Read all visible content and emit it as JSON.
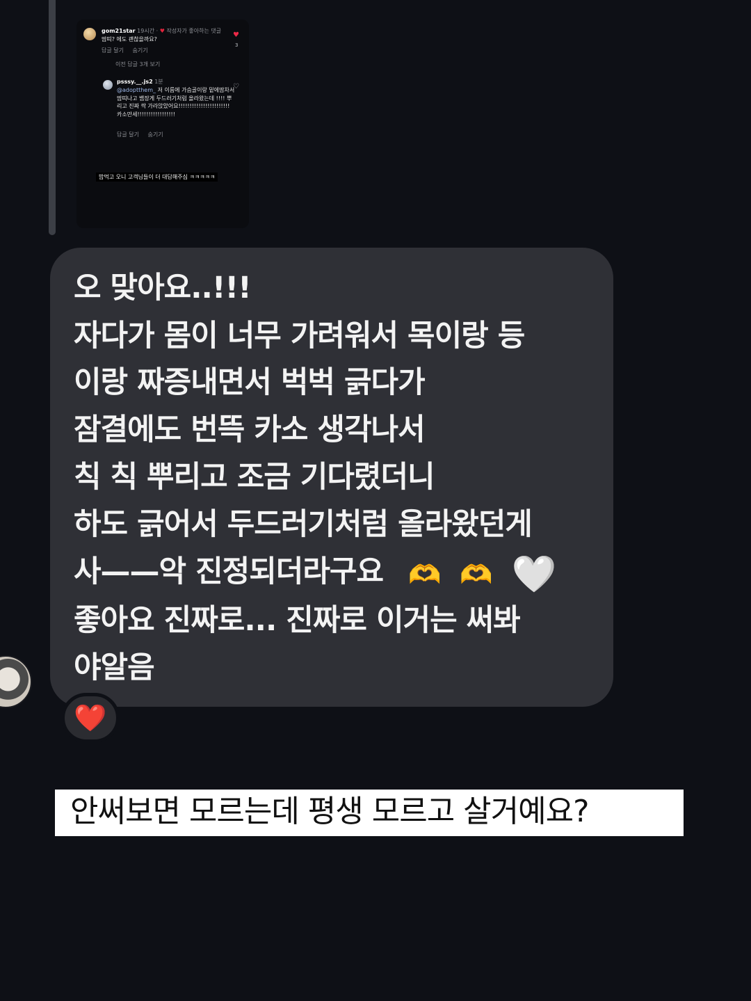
{
  "shared_post": {
    "comment": {
      "username": "gom21star",
      "time": "19시간",
      "creator_liked": "작성자가 좋아하는 댓글",
      "text": "땀띠? 에도 괜찮을까요?",
      "reply_action": "답글 달기",
      "hide_action": "숨기기",
      "like_count": "3"
    },
    "view_previous_replies": "이전 답글 3개 보기",
    "reply": {
      "username": "psssy.__.js2",
      "time": "1분",
      "mention": "@adoptthem_",
      "text": "저 이름에 가슴골이랑 밑에땀차서 땀띠나고 뱀장게 두드러기처럼 올라왔는데 !!!! 뿌리고 진짜 싹 가라앉았어요!!!!!!!!!!!!!!!!!!!!!!! 카소만세!!!!!!!!!!!!!!!!!",
      "reply_action": "답글 달기",
      "hide_action": "숨기기"
    },
    "caption": "밥먹고 오니 고객님들이 더 대답해주심 ㅋㅋㅋㅋㅋ"
  },
  "message": {
    "lines": [
      "오 맞아요..!!!",
      "자다가 몸이 너무 가려워서 목이랑 등",
      "이랑 짜증내면서 벅벅 긁다가",
      "잠결에도 번뜩 카소 생각나서",
      "칙 칙 뿌리고 조금 기다렸더니",
      "하도 긁어서 두드러기처럼 올라왔던게",
      "사——악 진정되더라구요",
      "좋아요 진짜로... 진짜로 이거는 써봐",
      "야알음"
    ],
    "emojis": [
      "🫶",
      "🫶",
      "🤍"
    ],
    "reaction": "❤️"
  },
  "overlay_caption": "안써보면 모르는데 평생 모르고 살거예요?",
  "colors": {
    "background": "#0e1016",
    "bubble": "#2f3036",
    "caption_bg": "#ffffff",
    "reaction_heart": "#e2243a"
  }
}
